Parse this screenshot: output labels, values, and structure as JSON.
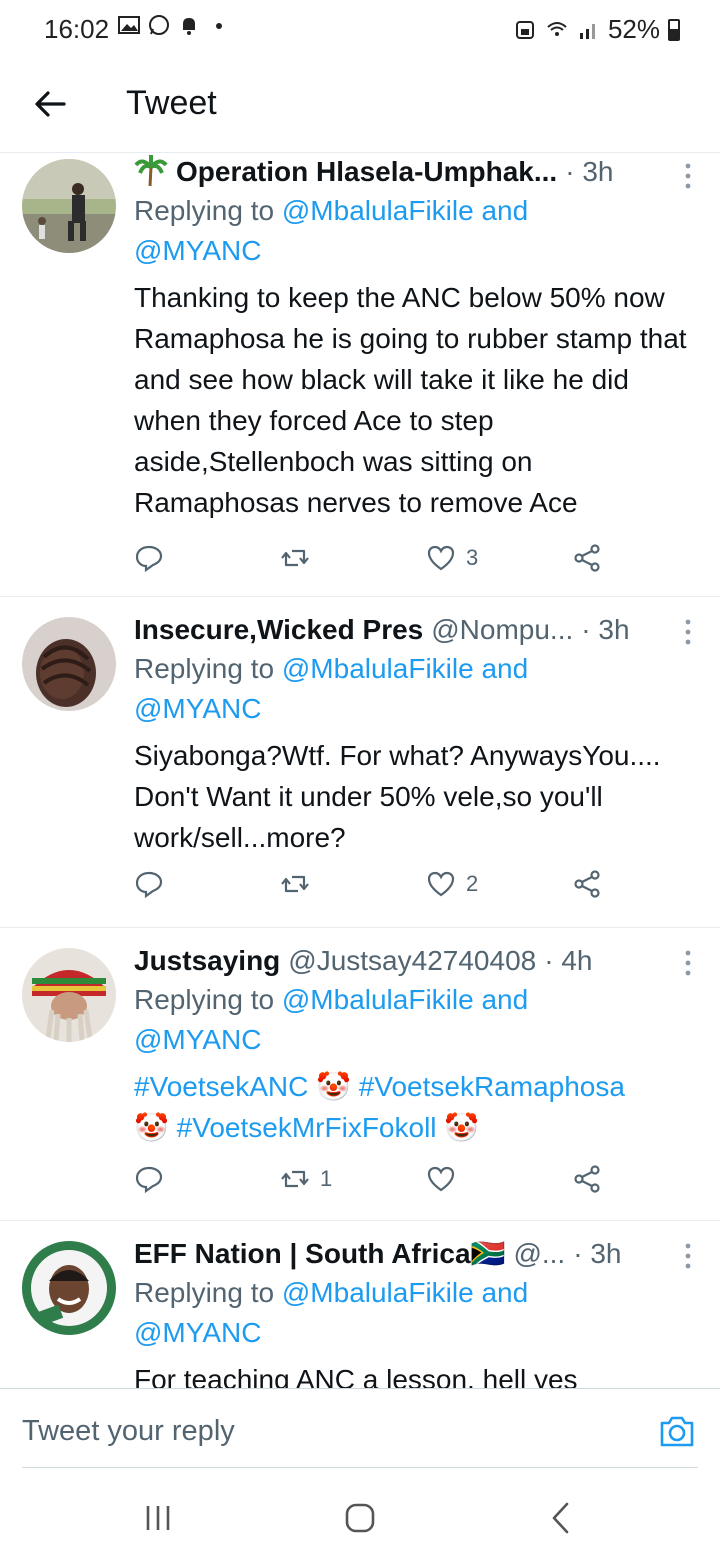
{
  "status_bar": {
    "time": "16:02",
    "battery": "52%"
  },
  "header": {
    "title": "Tweet"
  },
  "tweets": [
    {
      "name": "Operation Hlasela-Umphak...",
      "handle": "",
      "time": "· 3h",
      "reply_prefix": "Replying to ",
      "reply_mention1": "@MbalulaFikile",
      "reply_and": " and",
      "reply_mention2": "@MYANC",
      "text": "Thanking to keep the ANC below 50% now Ramaphosa he is going to rubber stamp that and see how black will take it like he did when they forced Ace to step aside,Stellenboch was sitting on Ramaphosas nerves to remove Ace",
      "retweets": "",
      "likes": "3"
    },
    {
      "name": "Insecure,Wicked Pres",
      "handle": "@Nompu...",
      "time": "· 3h",
      "reply_prefix": "Replying to ",
      "reply_mention1": "@MbalulaFikile",
      "reply_and": " and",
      "reply_mention2": "@MYANC",
      "text": "Siyabonga?Wtf. For what? AnywaysYou.... Don't Want it under 50% vele,so you'll work/sell...more?",
      "retweets": "",
      "likes": "2"
    },
    {
      "name": "Justsaying",
      "handle": "@Justsay42740408",
      "time": "· 4h",
      "reply_prefix": "Replying to ",
      "reply_mention1": "@MbalulaFikile",
      "reply_and": " and",
      "reply_mention2": "@MYANC",
      "hashtags": [
        "#VoetsekANC",
        "#VoetsekRamaphosa",
        "#VoetsekMrFixFokoll"
      ],
      "emoji": "🤡",
      "retweets": "1",
      "likes": ""
    },
    {
      "name": "EFF Nation | South Africa",
      "flag": "🇿🇦",
      "handle": "@...",
      "time": "· 3h",
      "reply_prefix": "Replying to ",
      "reply_mention1": "@MbalulaFikile",
      "reply_and": " and",
      "reply_mention2": "@MYANC",
      "text": "For teaching ANC a lesson, hell yes"
    }
  ],
  "reply_bar": {
    "placeholder": "Tweet your reply"
  },
  "colors": {
    "accent": "#1d9bf0",
    "secondary_text": "#536471",
    "divider": "#e6ecf0"
  },
  "icons": [
    "back-arrow-icon",
    "more-vert-icon",
    "reply-icon",
    "retweet-icon",
    "like-icon",
    "share-icon",
    "camera-icon",
    "recents-icon",
    "home-icon",
    "back-icon"
  ]
}
